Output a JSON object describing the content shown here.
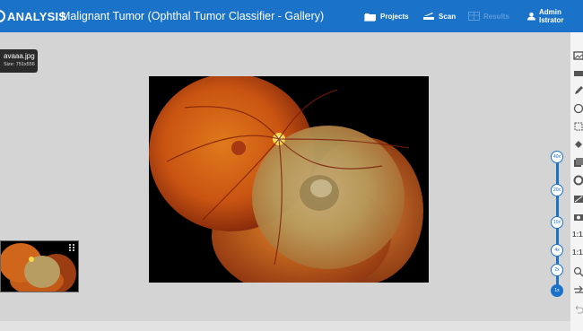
{
  "header": {
    "brand": "ANALYSIS",
    "title": "Malignant Tumor (Ophthal Tumor Classifier - Gallery)",
    "nav": {
      "projects": "Projects",
      "scan": "Scan",
      "results": "Results",
      "user": "Admin Istrator"
    }
  },
  "image": {
    "filename": "avaaa.jpg",
    "size_label": "Size: 751x556"
  },
  "zoom": {
    "levels": [
      "40x",
      "20x",
      "10x",
      "4x",
      "2x",
      "1x"
    ],
    "active": "1x"
  },
  "toolbar": {
    "ratio_label_1": "1:1",
    "ratio_label_2": "1:1"
  },
  "colors": {
    "header": "#1a73c8",
    "workspace": "#d4d4d4",
    "accent": "#1a73c8"
  }
}
